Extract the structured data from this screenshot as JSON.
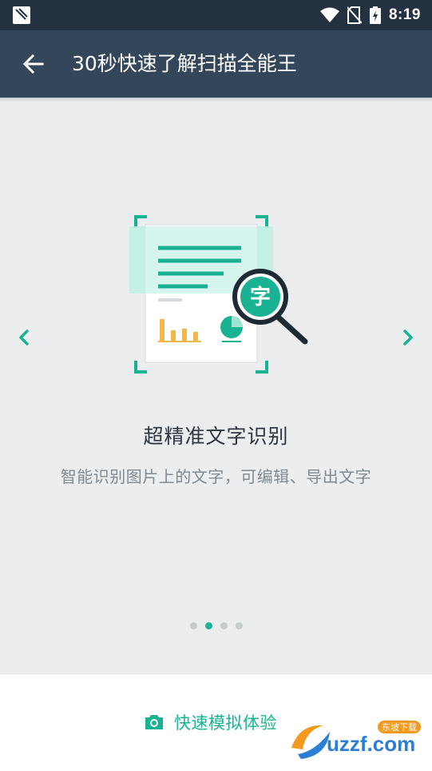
{
  "status_bar": {
    "time": "8:19",
    "icons": [
      "app-notification-icon",
      "wifi-icon",
      "no-sim-icon",
      "battery-charging-icon"
    ]
  },
  "app_bar": {
    "back_icon": "arrow-back-icon",
    "title": "30秒快速了解扫描全能王"
  },
  "slide": {
    "title": "超精准文字识别",
    "description": "智能识别图片上的文字，可编辑、导出文字",
    "magnifier_char": "字"
  },
  "pager": {
    "count": 4,
    "active_index": 1
  },
  "bottom": {
    "demo_label": "快速模拟体验",
    "demo_icon": "camera-icon"
  },
  "watermark": {
    "text": "uzzf.com",
    "tag": "东坡下载"
  },
  "colors": {
    "status_bar": "#243141",
    "app_bar": "#34475a",
    "accent": "#19b393",
    "background": "#ebedee"
  }
}
